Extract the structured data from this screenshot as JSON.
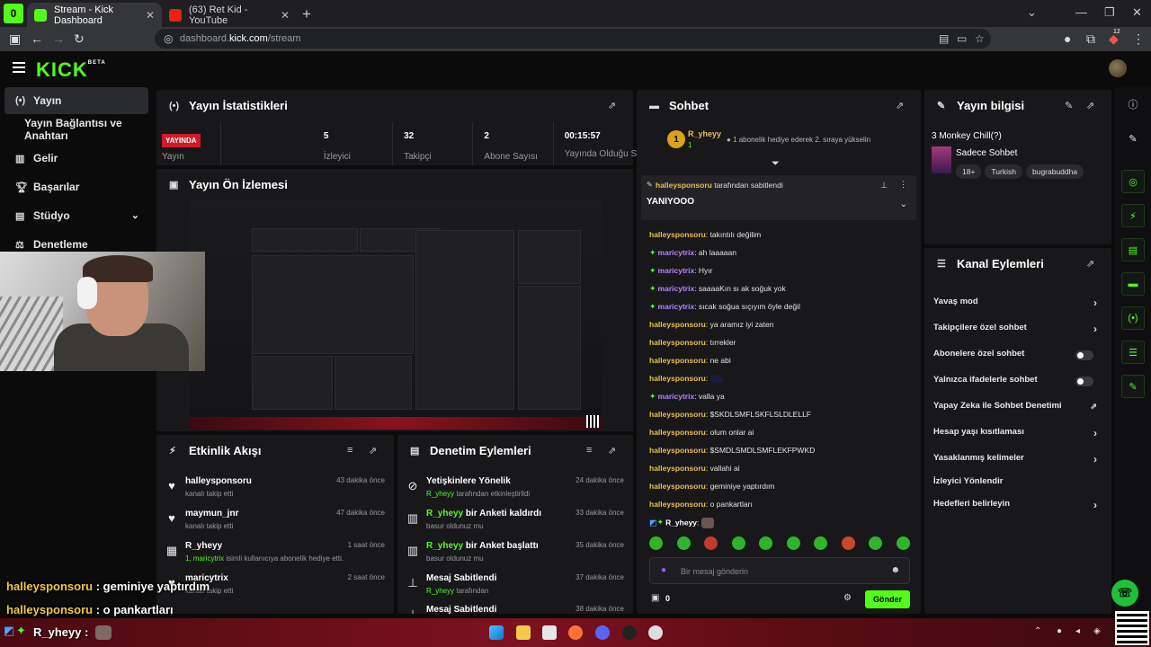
{
  "browser": {
    "ext_badge": "0",
    "tabs": [
      {
        "label": "Stream - Kick Dashboard",
        "active": true
      },
      {
        "label": "(63) Ret Kid - YouTube",
        "active": false
      }
    ],
    "url_prefix": "dashboard.",
    "url_domain": "kick.com",
    "url_path": "/stream",
    "ext_count": "12"
  },
  "header": {
    "logo": "KICK",
    "logo_sup": "BETA"
  },
  "leftnav": {
    "items": [
      {
        "label": "Yayın",
        "icon": "broadcast-icon"
      },
      {
        "label": "Yayın Bağlantısı ve Anahtarı",
        "icon": ""
      },
      {
        "label": "Gelir",
        "icon": "chart-icon"
      },
      {
        "label": "Başarılar",
        "icon": "trophy-icon"
      },
      {
        "label": "Stüdyo",
        "icon": "studio-icon"
      },
      {
        "label": "Denetleme",
        "icon": "moderation-icon"
      }
    ]
  },
  "stats": {
    "title": "Yayın İstatistikleri",
    "live_badge": "YAYINDA",
    "status_label": "Yayın",
    "items": [
      {
        "value": "5",
        "label": "İzleyici"
      },
      {
        "value": "32",
        "label": "Takipçi"
      },
      {
        "value": "2",
        "label": "Abone Sayısı"
      },
      {
        "value": "00:15:57",
        "label": "Yayında Olduğu Süre"
      }
    ]
  },
  "preview": {
    "title": "Yayın Ön İzlemesi"
  },
  "activity": {
    "title": "Etkinlik Akışı",
    "rows": [
      {
        "user": "halleysponsoru",
        "action": "kanalı takip etti",
        "time": "43 dakika önce",
        "icon": "heart-icon"
      },
      {
        "user": "maymun_jnr",
        "action": "kanalı takip etti",
        "time": "47 dakika önce",
        "icon": "heart-icon"
      },
      {
        "user": "R_yheyy",
        "action_user": "1, maricytrix",
        "action": "isimli kullanıcıya abonelik hediye etti.",
        "time": "1 saat önce",
        "icon": "gift-icon"
      },
      {
        "user": "maricytrix",
        "action": "kanalı takip etti",
        "time": "2 saat önce",
        "icon": "heart-icon"
      }
    ]
  },
  "moderation": {
    "title": "Denetim Eylemleri",
    "rows": [
      {
        "main": "Yetişkinlere Yönelik",
        "actor": "R_yheyy",
        "sub": "tarafından etkinleştirildi",
        "time": "24 dakika önce",
        "icon": "eye-off-icon"
      },
      {
        "actor": "R_yheyy",
        "main": "bir Anketi kaldırdı",
        "sub": "basur oldunuz mu",
        "time": "33 dakika önce",
        "icon": "poll-icon"
      },
      {
        "actor": "R_yheyy",
        "main": "bir Anket başlattı",
        "sub": "basur oldunuz mu",
        "time": "35 dakika önce",
        "icon": "poll-icon"
      },
      {
        "main": "Mesaj Sabitlendi",
        "actor": "R_yheyy",
        "sub": "tarafından",
        "time": "37 dakika önce",
        "icon": "pin-icon"
      },
      {
        "main": "Mesaj Sabitlendi",
        "time": "38 dakika önce",
        "icon": "pin-icon"
      }
    ]
  },
  "chat": {
    "title": "Sohbet",
    "leader": {
      "rank": "1",
      "user": "R_yheyy",
      "count": "1",
      "note": "1 abonelik hediye ederek 2. sıraya yükselin"
    },
    "pinned": {
      "by_user": "halleysponsoru",
      "by_text": "tarafından sabitlendi",
      "message": "YANIYOOO"
    },
    "messages": [
      {
        "user": "halleysponsoru",
        "text": "takıntılı değilim",
        "badge": false
      },
      {
        "user": "maricytrix",
        "text": "ah laaaaan",
        "badge": true
      },
      {
        "user": "maricytrix",
        "text": "Hyır",
        "badge": true
      },
      {
        "user": "maricytrix",
        "text": "saaaaKın sı ak soğuk yok",
        "badge": true
      },
      {
        "user": "maricytrix",
        "text": "sıcak soğua sıçıyım öyle değil",
        "badge": true
      },
      {
        "user": "halleysponsoru",
        "text": "ya aramız iyi zaten",
        "badge": false
      },
      {
        "user": "halleysponsoru",
        "text": "tırrekler",
        "badge": false
      },
      {
        "user": "halleysponsoru",
        "text": "ne abi",
        "badge": false
      },
      {
        "user": "halleysponsoru",
        "text": "",
        "badge": false
      },
      {
        "user": "maricytrix",
        "text": "valla ya",
        "badge": true
      },
      {
        "user": "halleysponsoru",
        "text": "$SKDLSMFLSKFLSLDLELLF",
        "badge": false
      },
      {
        "user": "halleysponsoru",
        "text": "olum onlar ai",
        "badge": false
      },
      {
        "user": "halleysponsoru",
        "text": "$SMDLSMDLSMFLEKFPWKD",
        "badge": false
      },
      {
        "user": "halleysponsoru",
        "text": "vallahi ai",
        "badge": false
      },
      {
        "user": "halleysponsoru",
        "text": "geminiye yaptırdım",
        "badge": false
      },
      {
        "user": "halleysponsoru",
        "text": "o pankartları",
        "badge": false
      },
      {
        "user": "R_yheyy",
        "text": "",
        "badge": true
      }
    ],
    "input_placeholder": "Bir mesaj gönderin",
    "points": "0",
    "send_label": "Gönder"
  },
  "stream_info": {
    "title": "Yayın bilgisi",
    "stream_title": "3 Monkey Chill(?)",
    "category": "Sadece Sohbet",
    "tags": [
      "18+",
      "Turkish",
      "bugrabuddha"
    ]
  },
  "channel_actions": {
    "title": "Kanal Eylemleri",
    "rows": [
      {
        "label": "Yavaş mod",
        "control": "arrow"
      },
      {
        "label": "Takipçilere özel sohbet",
        "control": "arrow"
      },
      {
        "label": "Abonelere özel sohbet",
        "control": "toggle"
      },
      {
        "label": "Yalnızca ifadelerle sohbet",
        "control": "toggle"
      },
      {
        "label": "Yapay Zeka ile Sohbet Denetimi",
        "control": "external"
      },
      {
        "label": "Hesap yaşı kısıtlaması",
        "control": "arrow"
      },
      {
        "label": "Yasaklanmış kelimeler",
        "control": "arrow"
      },
      {
        "label": "İzleyici Yönlendir",
        "control": "none"
      },
      {
        "label": "Hedefleri belirleyin",
        "control": "arrow"
      }
    ]
  },
  "overlay": {
    "lines": [
      {
        "user": "halleysponsoru",
        "text": ": geminiye yaptırdım"
      },
      {
        "user": "halleysponsoru",
        "text": ": o pankartları"
      }
    ],
    "bottom_user": "R_yheyy :"
  },
  "colors": {
    "brand": "#53fc18",
    "live": "#d11a2a",
    "panel": "#18181b"
  }
}
